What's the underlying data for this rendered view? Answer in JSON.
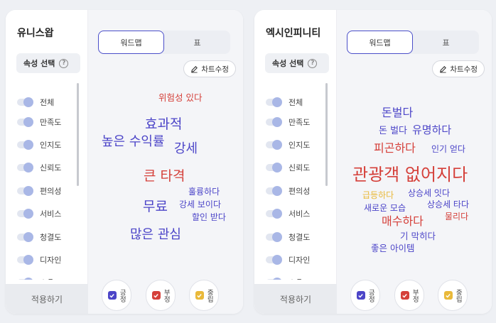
{
  "colors": {
    "positive": "#4c45c8",
    "negative": "#d5403a",
    "neutral": "#e9b93a"
  },
  "panels": [
    {
      "brand": "유니스왑",
      "attr_title": "속성 선택",
      "attrs": [
        "전체",
        "만족도",
        "인지도",
        "신뢰도",
        "편의성",
        "서비스",
        "청결도",
        "디자인",
        "소음"
      ],
      "apply": "적용하기",
      "tabs": [
        "워드맵",
        "표"
      ],
      "edit_label": "차트수정",
      "legend": [
        "긍정",
        "부정",
        "중립"
      ],
      "words": [
        {
          "text": "위험성 있다",
          "sentiment": "negative"
        },
        {
          "text": "효과적",
          "sentiment": "positive"
        },
        {
          "text": "높은 수익률",
          "sentiment": "positive"
        },
        {
          "text": "강세",
          "sentiment": "positive"
        },
        {
          "text": "큰 타격",
          "sentiment": "negative"
        },
        {
          "text": "훌륭하다",
          "sentiment": "positive"
        },
        {
          "text": "무료",
          "sentiment": "positive"
        },
        {
          "text": "강세 보이다",
          "sentiment": "positive"
        },
        {
          "text": "할인 받다",
          "sentiment": "positive"
        },
        {
          "text": "많은 관심",
          "sentiment": "positive"
        }
      ]
    },
    {
      "brand": "엑시인피니티",
      "attr_title": "속성 선택",
      "attrs": [
        "전체",
        "만족도",
        "인지도",
        "신뢰도",
        "편의성",
        "서비스",
        "청결도",
        "디자인",
        "소음"
      ],
      "apply": "적용하기",
      "tabs": [
        "워드맵",
        "표"
      ],
      "edit_label": "차트수정",
      "legend": [
        "긍정",
        "부정",
        "중립"
      ],
      "words": [
        {
          "text": "돈벌다",
          "sentiment": "positive"
        },
        {
          "text": "돈 벌다",
          "sentiment": "positive"
        },
        {
          "text": "유명하다",
          "sentiment": "positive"
        },
        {
          "text": "피곤하다",
          "sentiment": "negative"
        },
        {
          "text": "인기 얻다",
          "sentiment": "positive"
        },
        {
          "text": "관광객 없어지다",
          "sentiment": "negative"
        },
        {
          "text": "급등하다",
          "sentiment": "neutral"
        },
        {
          "text": "상승세 잇다",
          "sentiment": "positive"
        },
        {
          "text": "새로운 모습",
          "sentiment": "positive"
        },
        {
          "text": "상승세 타다",
          "sentiment": "positive"
        },
        {
          "text": "매수하다",
          "sentiment": "negative"
        },
        {
          "text": "물리다",
          "sentiment": "negative"
        },
        {
          "text": "기 막히다",
          "sentiment": "positive"
        },
        {
          "text": "좋은 아이템",
          "sentiment": "positive"
        }
      ]
    }
  ]
}
